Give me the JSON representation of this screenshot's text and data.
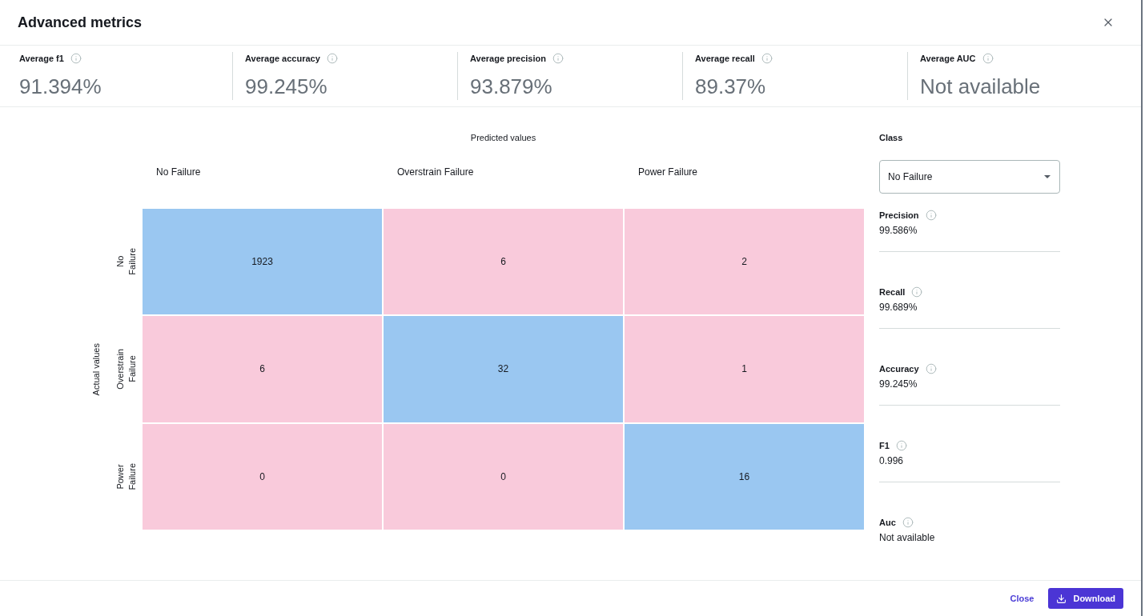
{
  "dialog": {
    "title": "Advanced metrics"
  },
  "summary_metrics": [
    {
      "label": "Average f1",
      "value": "91.394%"
    },
    {
      "label": "Average accuracy",
      "value": "99.245%"
    },
    {
      "label": "Average precision",
      "value": "93.879%"
    },
    {
      "label": "Average recall",
      "value": "89.37%"
    },
    {
      "label": "Average AUC",
      "value": "Not available"
    }
  ],
  "confusion_matrix": {
    "x_title": "Predicted values",
    "y_title": "Actual values",
    "columns": [
      "No Failure",
      "Overstrain Failure",
      "Power Failure"
    ],
    "rows": [
      {
        "label": "No Failure",
        "cells": [
          {
            "value": "1923",
            "color": "#9ac7f1"
          },
          {
            "value": "6",
            "color": "#f9cadb"
          },
          {
            "value": "2",
            "color": "#f9cadb"
          }
        ]
      },
      {
        "label": "Overstrain Failure",
        "cells": [
          {
            "value": "6",
            "color": "#f9cadb"
          },
          {
            "value": "32",
            "color": "#9ac7f1"
          },
          {
            "value": "1",
            "color": "#f9cadb"
          }
        ]
      },
      {
        "label": "Power Failure",
        "cells": [
          {
            "value": "0",
            "color": "#f9cadb"
          },
          {
            "value": "0",
            "color": "#f9cadb"
          },
          {
            "value": "16",
            "color": "#9ac7f1"
          }
        ]
      }
    ]
  },
  "class_panel": {
    "label": "Class",
    "select": {
      "value": "No Failure"
    },
    "metrics": [
      {
        "label": "Precision",
        "value": "99.586%"
      },
      {
        "label": "Recall",
        "value": "99.689%"
      },
      {
        "label": "Accuracy",
        "value": "99.245%"
      },
      {
        "label": "F1",
        "value": "0.996"
      },
      {
        "label": "Auc",
        "value": "Not available"
      }
    ]
  },
  "footer": {
    "buttons": [
      {
        "label": "Close",
        "kind": "link"
      },
      {
        "label": "Download",
        "kind": "primary"
      }
    ]
  }
}
